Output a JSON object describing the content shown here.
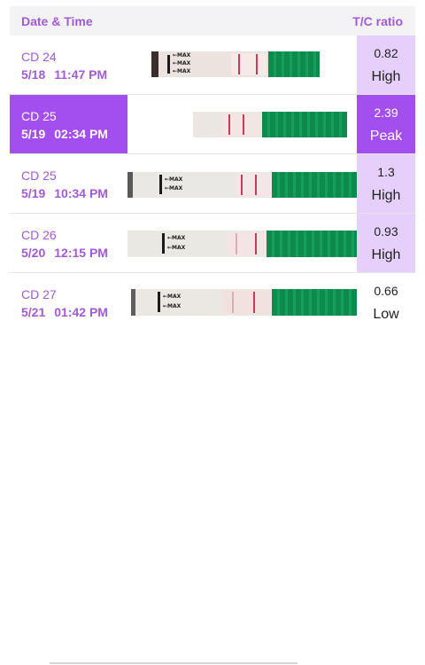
{
  "header": {
    "date_time_label": "Date & Time",
    "ratio_label": "T/C ratio"
  },
  "rows": [
    {
      "cd": "CD 24",
      "date": "5/18",
      "time": "11:47 PM",
      "ratio": "0.82",
      "level": "High"
    },
    {
      "cd": "CD 25",
      "date": "5/19",
      "time": "02:34 PM",
      "ratio": "2.39",
      "level": "Peak"
    },
    {
      "cd": "CD 25",
      "date": "5/19",
      "time": "10:34 PM",
      "ratio": "1.3",
      "level": "High"
    },
    {
      "cd": "CD 26",
      "date": "5/20",
      "time": "12:15 PM",
      "ratio": "0.93",
      "level": "High"
    },
    {
      "cd": "CD 27",
      "date": "5/21",
      "time": "01:42 PM",
      "ratio": "0.66",
      "level": "Low"
    }
  ],
  "strip_labels": {
    "max": "←MAX"
  },
  "colors": {
    "accent": "#a34ff0",
    "header_text": "#a25ad9",
    "ratio_highlight": "#e6d0fb",
    "strip_green": "#0e8a4c",
    "test_line": "#c73a5a"
  }
}
